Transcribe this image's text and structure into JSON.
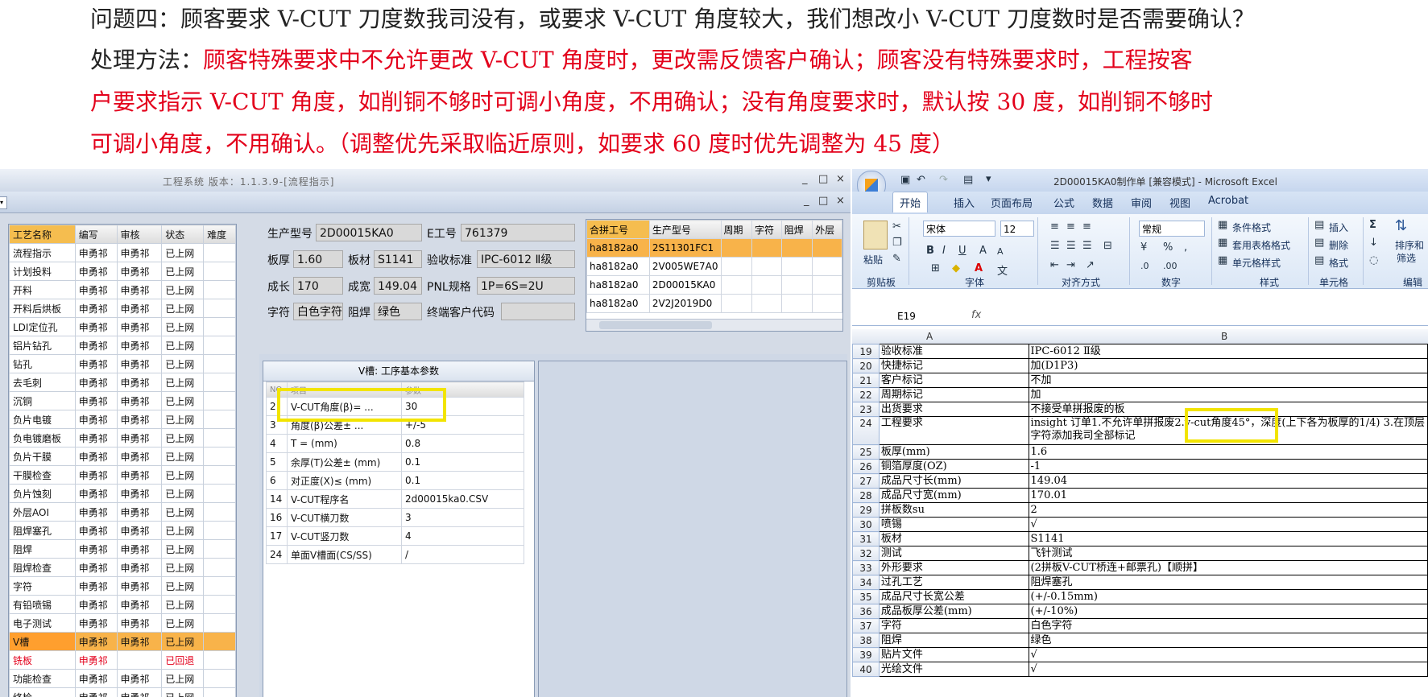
{
  "header": {
    "line1": "问题四：顾客要求 V-CUT 刀度数我司没有，或要求 V-CUT 角度较大，我们想改小 V-CUT 刀度数时是否需要确认？",
    "line2_label": "处理方法：",
    "line2_red": "顾客特殊要求中不允许更改 V-CUT 角度时，更改需反馈客户确认；顾客没有特殊要求时，工程按客",
    "line3": "户要求指示 V-CUT 角度，如削铜不够时可调小角度，不用确认；没有角度要求时，默认按 30 度，如削铜不够时",
    "line4": "可调小角度，不用确认。（调整优先采取临近原则，如要求 60 度时优先调整为 45 度）"
  },
  "eng_window": {
    "title": "工程系统 版本：1.1.3.9-[流程指示]",
    "btn_min": "_",
    "btn_max": "□",
    "btn_close": "×",
    "process_headers": [
      "工艺名称",
      "编写",
      "审核",
      "状态",
      "难度"
    ],
    "process_rows": [
      [
        "流程指示",
        "申勇祁",
        "申勇祁",
        "已上网",
        ""
      ],
      [
        "计划投料",
        "申勇祁",
        "申勇祁",
        "已上网",
        ""
      ],
      [
        "开料",
        "申勇祁",
        "申勇祁",
        "已上网",
        ""
      ],
      [
        "开料后烘板",
        "申勇祁",
        "申勇祁",
        "已上网",
        ""
      ],
      [
        "LDI定位孔",
        "申勇祁",
        "申勇祁",
        "已上网",
        ""
      ],
      [
        "铝片钻孔",
        "申勇祁",
        "申勇祁",
        "已上网",
        ""
      ],
      [
        "钻孔",
        "申勇祁",
        "申勇祁",
        "已上网",
        ""
      ],
      [
        "去毛刺",
        "申勇祁",
        "申勇祁",
        "已上网",
        ""
      ],
      [
        "沉铜",
        "申勇祁",
        "申勇祁",
        "已上网",
        ""
      ],
      [
        "负片电镀",
        "申勇祁",
        "申勇祁",
        "已上网",
        ""
      ],
      [
        "负电镀磨板",
        "申勇祁",
        "申勇祁",
        "已上网",
        ""
      ],
      [
        "负片干膜",
        "申勇祁",
        "申勇祁",
        "已上网",
        ""
      ],
      [
        "干膜检查",
        "申勇祁",
        "申勇祁",
        "已上网",
        ""
      ],
      [
        "负片蚀刻",
        "申勇祁",
        "申勇祁",
        "已上网",
        ""
      ],
      [
        "外层AOI",
        "申勇祁",
        "申勇祁",
        "已上网",
        ""
      ],
      [
        "阻焊塞孔",
        "申勇祁",
        "申勇祁",
        "已上网",
        ""
      ],
      [
        "阻焊",
        "申勇祁",
        "申勇祁",
        "已上网",
        ""
      ],
      [
        "阻焊检查",
        "申勇祁",
        "申勇祁",
        "已上网",
        ""
      ],
      [
        "字符",
        "申勇祁",
        "申勇祁",
        "已上网",
        ""
      ],
      [
        "有铅喷锡",
        "申勇祁",
        "申勇祁",
        "已上网",
        ""
      ],
      [
        "电子测试",
        "申勇祁",
        "申勇祁",
        "已上网",
        ""
      ],
      [
        "V槽",
        "申勇祁",
        "申勇祁",
        "已上网",
        ""
      ],
      [
        "铣板",
        "申勇祁",
        "",
        "已回退",
        ""
      ],
      [
        "功能检查",
        "申勇祁",
        "申勇祁",
        "已上网",
        ""
      ],
      [
        "终检",
        "申勇祁",
        "申勇祁",
        "已上网",
        ""
      ]
    ],
    "info": {
      "model_label": "生产型号",
      "model_value": "2D00015KA0",
      "eno_label": "E工号",
      "eno_value": "761379",
      "thick_label": "板厚",
      "thick_value": "1.60",
      "mat_label": "板材",
      "mat_value": "S1141",
      "std_label": "验收标准",
      "std_value": "IPC-6012 Ⅱ级",
      "len_label": "成长",
      "len_value": "170",
      "wid_label": "成宽",
      "wid_value": "149.04",
      "pnl_label": "PNL规格",
      "pnl_value": "1P=6S=2U",
      "char_label": "字符",
      "char_value": "白色字符",
      "mask_label": "阻焊",
      "mask_value": "绿色",
      "cust_label": "终端客户代码",
      "cust_value": ""
    },
    "merge_headers": [
      "合拼工号",
      "生产型号",
      "周期",
      "字符",
      "阻焊",
      "外层"
    ],
    "merge_rows": [
      [
        "ha8182a0",
        "2S11301FC1"
      ],
      [
        "ha8182a0",
        "2V005WE7A0"
      ],
      [
        "ha8182a0",
        "2D00015KA0"
      ],
      [
        "ha8182a0",
        "2V2J2019D0"
      ]
    ],
    "vgroove": {
      "caption": "V槽: 工序基本参数",
      "headers": [
        "NO",
        "项目",
        "参数"
      ],
      "rows": [
        [
          "2",
          "V-CUT角度(β)= ...",
          "30"
        ],
        [
          "3",
          "角度(β)公差± ...",
          "+/-5"
        ],
        [
          "4",
          "T = (mm)",
          "0.8"
        ],
        [
          "5",
          "余厚(T)公差± (mm)",
          "0.1"
        ],
        [
          "6",
          "对正度(X)≤ (mm)",
          "0.1"
        ],
        [
          "14",
          "V-CUT程序名",
          "2d00015ka0.CSV"
        ],
        [
          "16",
          "V-CUT横刀数",
          "3"
        ],
        [
          "17",
          "V-CUT竖刀数",
          "4"
        ],
        [
          "24",
          "单面V槽面(CS/SS)",
          "/"
        ]
      ]
    }
  },
  "excel": {
    "title": "2D00015KA0制作单 [兼容模式] - Microsoft Excel",
    "tabs": [
      "开始",
      "插入",
      "页面布局",
      "公式",
      "数据",
      "审阅",
      "视图",
      "Acrobat"
    ],
    "font_name": "宋体",
    "font_size": "12",
    "number_format": "常规",
    "ribbon": {
      "paste": "粘贴",
      "cond_format": "条件格式",
      "table_format": "套用表格格式",
      "cell_style": "单元格样式",
      "insert": "插入",
      "delete": "删除",
      "format": "格式",
      "sort_filter_1": "排序和",
      "sort_filter_2": "筛选",
      "groups": [
        "剪贴板",
        "字体",
        "对齐方式",
        "数字",
        "样式",
        "单元格",
        "编辑"
      ]
    },
    "cell_ref": "E19",
    "fx": "fx",
    "col_a": "A",
    "col_b": "B",
    "rows": [
      [
        "19",
        "验收标准",
        "IPC-6012 Ⅱ级"
      ],
      [
        "20",
        "快捷标记",
        "加(D1P3)"
      ],
      [
        "21",
        "客户标记",
        "不加"
      ],
      [
        "22",
        "周期标记",
        "加"
      ],
      [
        "23",
        "出货要求",
        "不接受单拼报废的板"
      ],
      [
        "24",
        "工程要求",
        "insight 订单1.不允许单拼报废2.v-cut角度45°，深度(上下各为板厚的1/4) 3.在顶层字符添加我司全部标记"
      ],
      [
        "25",
        "板厚(mm)",
        "1.6"
      ],
      [
        "26",
        "铜箔厚度(OZ)",
        "-1"
      ],
      [
        "27",
        "成品尺寸长(mm)",
        "149.04"
      ],
      [
        "28",
        "成品尺寸宽(mm)",
        "170.01"
      ],
      [
        "29",
        "拼板数su",
        "2"
      ],
      [
        "30",
        "喷锡",
        "√"
      ],
      [
        "31",
        "板材",
        "S1141"
      ],
      [
        "32",
        "测试",
        "飞针测试"
      ],
      [
        "33",
        "外形要求",
        "(2拼板V-CUT桥连+邮票孔)【顺拼】"
      ],
      [
        "34",
        "过孔工艺",
        "阻焊塞孔"
      ],
      [
        "35",
        "成品尺寸长宽公差",
        "(+/-0.15mm)"
      ],
      [
        "36",
        "成品板厚公差(mm)",
        "(+/-10%)"
      ],
      [
        "37",
        "字符",
        "白色字符"
      ],
      [
        "38",
        "阻焊",
        "绿色"
      ],
      [
        "39",
        "贴片文件",
        "√"
      ],
      [
        "40",
        "光绘文件",
        "√"
      ]
    ]
  },
  "colors": {
    "red": "#e3001b",
    "highlight": "#f8b34a",
    "callout": "#f2e400"
  }
}
